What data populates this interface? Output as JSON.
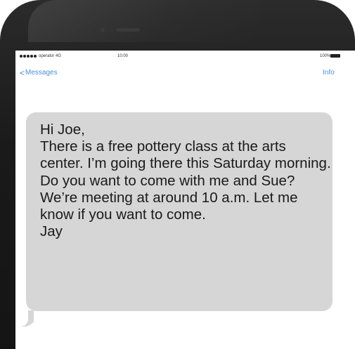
{
  "status_bar": {
    "carrier": "operator  4G",
    "time": "10:00",
    "battery": "100%"
  },
  "nav": {
    "back_label": "Messages",
    "back_chevron": "<",
    "info_label": "Info"
  },
  "message": {
    "text": "Hi Joe,\nThere is a free pottery class at the arts center. I’m going there this Saturday morning.  Do you want to come with me and Sue? We’re meeting at around 10 a.m. Let me know if you want to come.\nJay"
  },
  "colors": {
    "accent": "#4a90d9",
    "bubble": "#d6d6d6",
    "bezel": "#1a1a1a"
  }
}
